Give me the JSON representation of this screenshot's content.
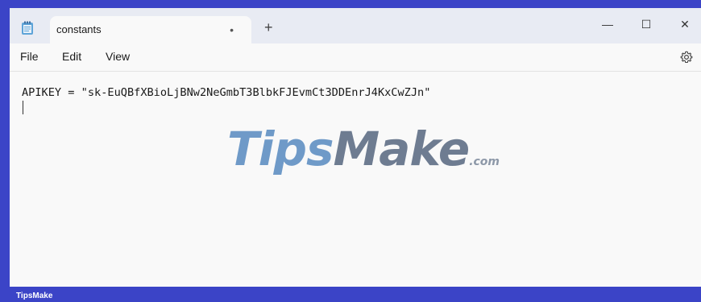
{
  "tab": {
    "title": "constants",
    "modified_indicator": "•",
    "new_tab_label": "+"
  },
  "window_controls": {
    "minimize": "—",
    "maximize": "☐",
    "close": "✕"
  },
  "menu": {
    "items": [
      "File",
      "Edit",
      "View"
    ],
    "settings_icon": "gear-icon"
  },
  "editor": {
    "line1": "APIKEY = \"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\""
  },
  "watermark": {
    "main": "Tips",
    "make": "Make",
    "suffix": ".com"
  },
  "footer": {
    "brand": "TipsMake"
  },
  "colors": {
    "frame_border": "#3b44c7",
    "titlebar": "#e8ebf3",
    "editor_bg": "#f9f9f9"
  }
}
